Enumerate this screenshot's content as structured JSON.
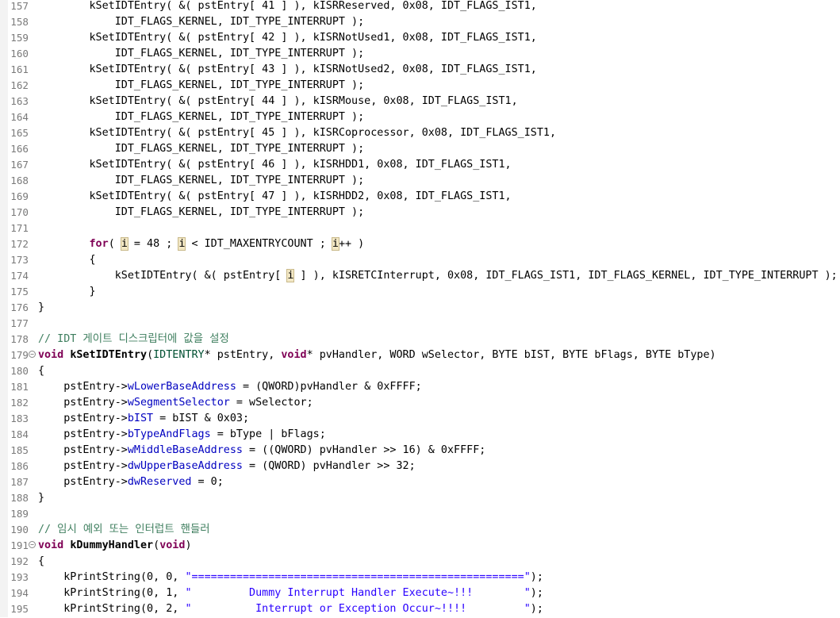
{
  "colors": {
    "keyword": "#7f0055",
    "comment": "#3f7f5f",
    "string": "#2a00ff",
    "field": "#0000c0",
    "type": "#005032",
    "line_number": "#7a7a7a",
    "background": "#ffffff",
    "occurrence_highlight": "#f2e7c4"
  },
  "editor": {
    "lines": [
      {
        "n": "157",
        "segs": [
          {
            "t": "        kSetIDTEntry( &( pstEntry[ 41 ] ), kISRReserved, 0x08, IDT_FLAGS_IST1,"
          }
        ]
      },
      {
        "n": "158",
        "segs": [
          {
            "t": "            IDT_FLAGS_KERNEL, IDT_TYPE_INTERRUPT );"
          }
        ]
      },
      {
        "n": "159",
        "segs": [
          {
            "t": "        kSetIDTEntry( &( pstEntry[ 42 ] ), kISRNotUsed1, 0x08, IDT_FLAGS_IST1,"
          }
        ]
      },
      {
        "n": "160",
        "segs": [
          {
            "t": "            IDT_FLAGS_KERNEL, IDT_TYPE_INTERRUPT );"
          }
        ]
      },
      {
        "n": "161",
        "segs": [
          {
            "t": "        kSetIDTEntry( &( pstEntry[ 43 ] ), kISRNotUsed2, 0x08, IDT_FLAGS_IST1,"
          }
        ]
      },
      {
        "n": "162",
        "segs": [
          {
            "t": "            IDT_FLAGS_KERNEL, IDT_TYPE_INTERRUPT );"
          }
        ]
      },
      {
        "n": "163",
        "segs": [
          {
            "t": "        kSetIDTEntry( &( pstEntry[ 44 ] ), kISRMouse, 0x08, IDT_FLAGS_IST1,"
          }
        ]
      },
      {
        "n": "164",
        "segs": [
          {
            "t": "            IDT_FLAGS_KERNEL, IDT_TYPE_INTERRUPT );"
          }
        ]
      },
      {
        "n": "165",
        "segs": [
          {
            "t": "        kSetIDTEntry( &( pstEntry[ 45 ] ), kISRCoprocessor, 0x08, IDT_FLAGS_IST1,"
          }
        ]
      },
      {
        "n": "166",
        "segs": [
          {
            "t": "            IDT_FLAGS_KERNEL, IDT_TYPE_INTERRUPT );"
          }
        ]
      },
      {
        "n": "167",
        "segs": [
          {
            "t": "        kSetIDTEntry( &( pstEntry[ 46 ] ), kISRHDD1, 0x08, IDT_FLAGS_IST1,"
          }
        ]
      },
      {
        "n": "168",
        "segs": [
          {
            "t": "            IDT_FLAGS_KERNEL, IDT_TYPE_INTERRUPT );"
          }
        ]
      },
      {
        "n": "169",
        "segs": [
          {
            "t": "        kSetIDTEntry( &( pstEntry[ 47 ] ), kISRHDD2, 0x08, IDT_FLAGS_IST1,"
          }
        ]
      },
      {
        "n": "170",
        "segs": [
          {
            "t": "            IDT_FLAGS_KERNEL, IDT_TYPE_INTERRUPT );"
          }
        ]
      },
      {
        "n": "171",
        "segs": []
      },
      {
        "n": "172",
        "segs": [
          {
            "t": "        "
          },
          {
            "t": "for",
            "c": "kw"
          },
          {
            "t": "( "
          },
          {
            "t": "i",
            "c": "occ"
          },
          {
            "t": " = 48 ; "
          },
          {
            "t": "i",
            "c": "occ"
          },
          {
            "t": " < IDT_MAXENTRYCOUNT ; "
          },
          {
            "t": "i",
            "c": "occ"
          },
          {
            "t": "++ )"
          }
        ]
      },
      {
        "n": "173",
        "segs": [
          {
            "t": "        {"
          }
        ]
      },
      {
        "n": "174",
        "segs": [
          {
            "t": "            kSetIDTEntry( &( pstEntry[ "
          },
          {
            "t": "i",
            "c": "occ"
          },
          {
            "t": " ] ), kISRETCInterrupt, 0x08, IDT_FLAGS_IST1, IDT_FLAGS_KERNEL, IDT_TYPE_INTERRUPT );"
          }
        ]
      },
      {
        "n": "175",
        "segs": [
          {
            "t": "        }"
          }
        ]
      },
      {
        "n": "176",
        "segs": [
          {
            "t": "}"
          }
        ]
      },
      {
        "n": "177",
        "segs": []
      },
      {
        "n": "178",
        "segs": [
          {
            "t": "// IDT 게이트 디스크립터에 값을 설정",
            "c": "cm"
          }
        ]
      },
      {
        "n": "179",
        "fold": true,
        "segs": [
          {
            "t": "void",
            "c": "kw"
          },
          {
            "t": " "
          },
          {
            "t": "kSetIDTEntry",
            "c": "fn"
          },
          {
            "t": "("
          },
          {
            "t": "IDTENTRY",
            "c": "ty"
          },
          {
            "t": "* pstEntry, "
          },
          {
            "t": "void",
            "c": "kw"
          },
          {
            "t": "* pvHandler, WORD wSelector, BYTE bIST, BYTE bFlags, BYTE bType)"
          }
        ]
      },
      {
        "n": "180",
        "segs": [
          {
            "t": "{"
          }
        ]
      },
      {
        "n": "181",
        "segs": [
          {
            "t": "    pstEntry->"
          },
          {
            "t": "wLowerBaseAddress",
            "c": "fld"
          },
          {
            "t": " = (QWORD)pvHandler & 0xFFFF;"
          }
        ]
      },
      {
        "n": "182",
        "segs": [
          {
            "t": "    pstEntry->"
          },
          {
            "t": "wSegmentSelector",
            "c": "fld"
          },
          {
            "t": " = wSelector;"
          }
        ]
      },
      {
        "n": "183",
        "segs": [
          {
            "t": "    pstEntry->"
          },
          {
            "t": "bIST",
            "c": "fld"
          },
          {
            "t": " = bIST & 0x03;"
          }
        ]
      },
      {
        "n": "184",
        "segs": [
          {
            "t": "    pstEntry->"
          },
          {
            "t": "bTypeAndFlags",
            "c": "fld"
          },
          {
            "t": " = bType | bFlags;"
          }
        ]
      },
      {
        "n": "185",
        "segs": [
          {
            "t": "    pstEntry->"
          },
          {
            "t": "wMiddleBaseAddress",
            "c": "fld"
          },
          {
            "t": " = ((QWORD) pvHandler >> 16) & 0xFFFF;"
          }
        ]
      },
      {
        "n": "186",
        "segs": [
          {
            "t": "    pstEntry->"
          },
          {
            "t": "dwUpperBaseAddress",
            "c": "fld"
          },
          {
            "t": " = (QWORD) pvHandler >> 32;"
          }
        ]
      },
      {
        "n": "187",
        "segs": [
          {
            "t": "    pstEntry->"
          },
          {
            "t": "dwReserved",
            "c": "fld"
          },
          {
            "t": " = 0;"
          }
        ]
      },
      {
        "n": "188",
        "segs": [
          {
            "t": "}"
          }
        ]
      },
      {
        "n": "189",
        "segs": []
      },
      {
        "n": "190",
        "segs": [
          {
            "t": "// 임시 예외 또는 인터럽트 핸들러",
            "c": "cm"
          }
        ]
      },
      {
        "n": "191",
        "fold": true,
        "segs": [
          {
            "t": "void",
            "c": "kw"
          },
          {
            "t": " "
          },
          {
            "t": "kDummyHandler",
            "c": "fn"
          },
          {
            "t": "("
          },
          {
            "t": "void",
            "c": "kw"
          },
          {
            "t": ")"
          }
        ]
      },
      {
        "n": "192",
        "segs": [
          {
            "t": "{"
          }
        ]
      },
      {
        "n": "193",
        "segs": [
          {
            "t": "    kPrintString(0, 0, "
          },
          {
            "t": "\"====================================================\"",
            "c": "str"
          },
          {
            "t": ");"
          }
        ]
      },
      {
        "n": "194",
        "segs": [
          {
            "t": "    kPrintString(0, 1, "
          },
          {
            "t": "\"         Dummy Interrupt Handler Execute~!!!        \"",
            "c": "str"
          },
          {
            "t": ");"
          }
        ]
      },
      {
        "n": "195",
        "segs": [
          {
            "t": "    kPrintString(0, 2, "
          },
          {
            "t": "\"          Interrupt or Exception Occur~!!!!         \"",
            "c": "str"
          },
          {
            "t": ");"
          }
        ]
      }
    ]
  }
}
